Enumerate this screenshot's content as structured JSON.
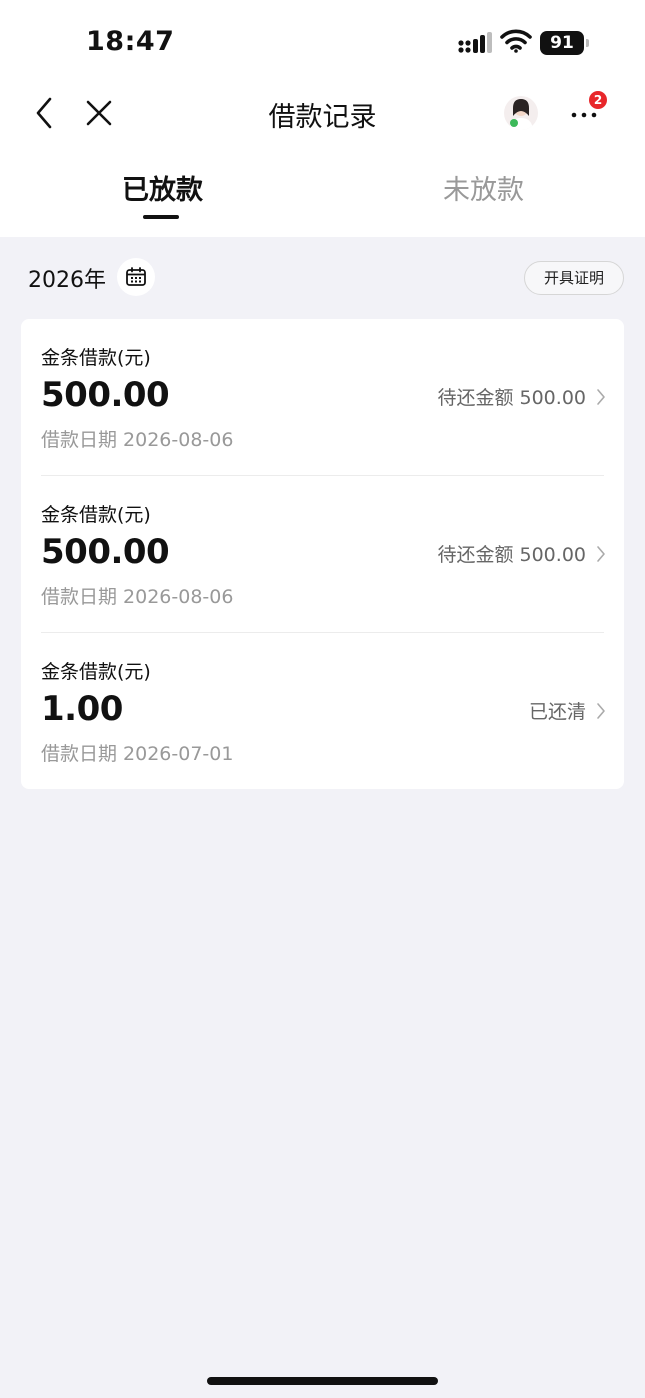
{
  "status_bar": {
    "time": "18:47",
    "battery": "91"
  },
  "nav": {
    "title": "借款记录",
    "badge_count": "2"
  },
  "tabs": [
    {
      "label": "已放款",
      "active": true
    },
    {
      "label": "未放款",
      "active": false
    }
  ],
  "filter": {
    "year": "2026年",
    "certificate_button": "开具证明"
  },
  "loans": [
    {
      "type": "金条借款(元)",
      "amount": "500.00",
      "date": "借款日期 2026-08-06",
      "status": "待还金额 500.00"
    },
    {
      "type": "金条借款(元)",
      "amount": "500.00",
      "date": "借款日期 2026-08-06",
      "status": "待还金额 500.00"
    },
    {
      "type": "金条借款(元)",
      "amount": "1.00",
      "date": "借款日期 2026-07-01",
      "status": "已还清"
    }
  ],
  "icons": {
    "back": "chevron-left-icon",
    "close": "close-icon",
    "more": "more-icon",
    "calendar": "calendar-icon",
    "signal": "signal-icon",
    "wifi": "wifi-icon"
  },
  "colors": {
    "badge": "#e8262a",
    "background": "#f2f2f7",
    "muted_text": "#999999"
  }
}
